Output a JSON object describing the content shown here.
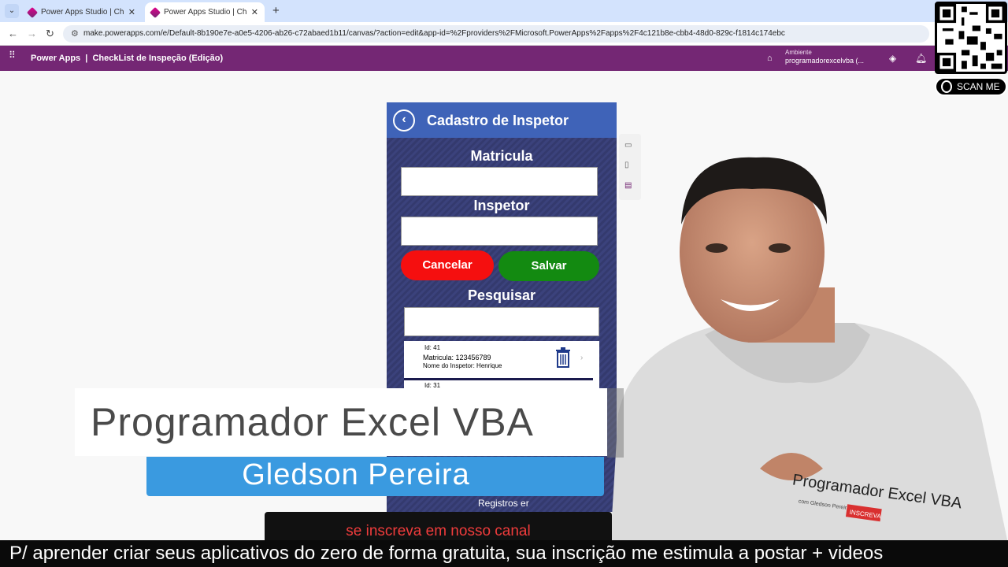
{
  "browser": {
    "tabs": [
      {
        "title": "Power Apps Studio | CheckList",
        "close": "✕"
      },
      {
        "title": "Power Apps Studio | CheckList",
        "close": "✕"
      }
    ],
    "tab_list_icon": "⌄",
    "new_tab": "+",
    "back": "←",
    "forward": "→",
    "reload": "↻",
    "url": "make.powerapps.com/e/Default-8b190e7e-a0e5-4206-ab26-c72abaed1b11/canvas/?action=edit&app-id=%2Fproviders%2FMicrosoft.PowerApps%2Fapps%2F4c121b8e-cbb4-48d0-829c-f1814c174ebc"
  },
  "header": {
    "app_title": "Power Apps  |  CheckList de Inspeção (Edição)",
    "env_label": "Ambiente",
    "env_name": "programadorexcelvba (..."
  },
  "app": {
    "screen_title": "Cadastro de Inspetor",
    "matricula_label": "Matricula",
    "inspetor_label": "Inspetor",
    "cancel_label": "Cancelar",
    "save_label": "Salvar",
    "search_label": "Pesquisar",
    "gallery": [
      {
        "id": "Id: 41",
        "matricula": "Matricula: 123456789",
        "nome": "Nome do Inspetor: Henrique"
      },
      {
        "id": "Id: 31"
      }
    ],
    "footer": "Registros er"
  },
  "overlay": {
    "qr_caption": "SCAN ME",
    "lower_third_name": "Programador Excel VBA",
    "lower_third_sub": "Gledson Pereira",
    "subscribe": "se inscreva em nosso canal",
    "caption": "P/ aprender criar seus aplicativos do zero de forma gratuita, sua inscrição me estimula a postar + videos",
    "shirt_logo": "Programador Excel VBA",
    "shirt_small": "com Gledson Pereira",
    "shirt_badge": "INSCREVA"
  },
  "colors": {
    "purple_header": "#742774",
    "app_blue": "#3f63b8",
    "cancel_red": "#f50f0f",
    "save_green": "#138a11",
    "lower_third_blue": "#3a9ae0",
    "subscribe_red": "#f03c3c"
  }
}
